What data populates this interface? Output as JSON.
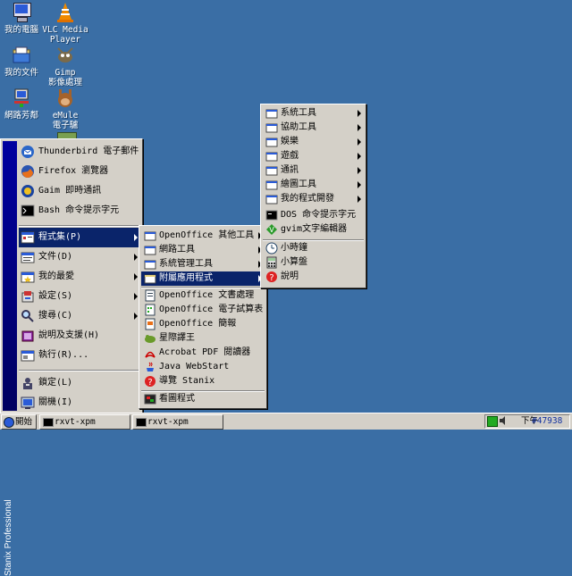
{
  "desktop": {
    "icons": [
      {
        "label": "我的電腦",
        "icon": "monitor-icon"
      },
      {
        "label": "VLC Media\nPlayer",
        "icon": "vlc-cone-icon"
      },
      {
        "label": "我的文件",
        "icon": "folder-icon"
      },
      {
        "label": "Gimp\n影像處理",
        "icon": "gimp-icon"
      },
      {
        "label": "網路芳鄰",
        "icon": "network-icon"
      },
      {
        "label": "eMule\n電子驢",
        "icon": "emule-icon"
      }
    ]
  },
  "start_menu": {
    "side_label": "Stanix Professional",
    "top_items": [
      {
        "label": "Thunderbird 電子郵件",
        "icon": "thunderbird-icon"
      },
      {
        "label": "Firefox 瀏覽器",
        "icon": "firefox-icon"
      },
      {
        "label": "Gaim 即時通訊",
        "icon": "gaim-icon"
      },
      {
        "label": "Bash 命令提示字元",
        "icon": "terminal-icon"
      }
    ],
    "items": [
      {
        "label": "程式集(P)",
        "icon": "programs-icon",
        "submenu": true,
        "selected": true
      },
      {
        "label": "文件(D)",
        "icon": "documents-icon",
        "submenu": true
      },
      {
        "label": "我的最愛",
        "icon": "favorites-icon",
        "submenu": true
      },
      {
        "label": "設定(S)",
        "icon": "settings-icon",
        "submenu": true
      },
      {
        "label": "搜尋(C)",
        "icon": "search-icon",
        "submenu": true
      },
      {
        "label": "說明及支援(H)",
        "icon": "help-book-icon"
      },
      {
        "label": "執行(R)...",
        "icon": "run-icon"
      }
    ],
    "bottom_items": [
      {
        "label": "鎖定(L)",
        "icon": "lock-icon"
      },
      {
        "label": "關機(I)",
        "icon": "shutdown-icon"
      }
    ]
  },
  "programs_menu": {
    "items": [
      {
        "label": "OpenOffice 其他工具",
        "icon": "folder-icon",
        "submenu": true
      },
      {
        "label": "網路工具",
        "icon": "folder-icon",
        "submenu": true
      },
      {
        "label": "系統管理工具",
        "icon": "folder-icon",
        "submenu": true
      },
      {
        "label": "附屬應用程式",
        "icon": "folder-icon",
        "submenu": true,
        "selected": true
      }
    ],
    "apps": [
      {
        "label": "OpenOffice 文書處理",
        "icon": "writer-icon"
      },
      {
        "label": "OpenOffice 電子試算表",
        "icon": "calc-icon"
      },
      {
        "label": "OpenOffice 簡報",
        "icon": "impress-icon"
      },
      {
        "label": "星際譯王",
        "icon": "stardict-icon"
      },
      {
        "label": "Acrobat PDF 閱讀器",
        "icon": "acrobat-icon"
      },
      {
        "label": "Java WebStart",
        "icon": "java-icon"
      },
      {
        "label": "導覽 Stanix",
        "icon": "tour-icon"
      }
    ],
    "footer": [
      {
        "label": "看圖程式",
        "icon": "image-viewer-icon"
      }
    ]
  },
  "accessories_menu": {
    "folders": [
      {
        "label": "系統工具",
        "icon": "folder-icon"
      },
      {
        "label": "協助工具",
        "icon": "folder-icon"
      },
      {
        "label": "娛樂",
        "icon": "folder-icon"
      },
      {
        "label": "遊戲",
        "icon": "folder-icon"
      },
      {
        "label": "通訊",
        "icon": "folder-icon"
      },
      {
        "label": "繪圖工具",
        "icon": "folder-icon"
      },
      {
        "label": "我的程式開發",
        "icon": "folder-icon"
      }
    ],
    "apps": [
      {
        "label": "DOS 命令提示字元",
        "icon": "dos-icon"
      },
      {
        "label": "gvim文字編輯器",
        "icon": "gvim-icon"
      }
    ],
    "tools": [
      {
        "label": "小時鐘",
        "icon": "clock-icon"
      },
      {
        "label": "小算盤",
        "icon": "calculator-icon"
      },
      {
        "label": "說明",
        "icon": "help-icon"
      }
    ]
  },
  "taskbar": {
    "start_label": "開始",
    "windows": [
      "rxvt-xpm",
      "rxvt-xpm"
    ],
    "tray_time": "下午",
    "tray_text": "#47938"
  },
  "colors": {
    "desktop": "#3a6ea5",
    "menu": "#d4d0c8",
    "highlight": "#0a246a",
    "side_bar": "#000080"
  }
}
